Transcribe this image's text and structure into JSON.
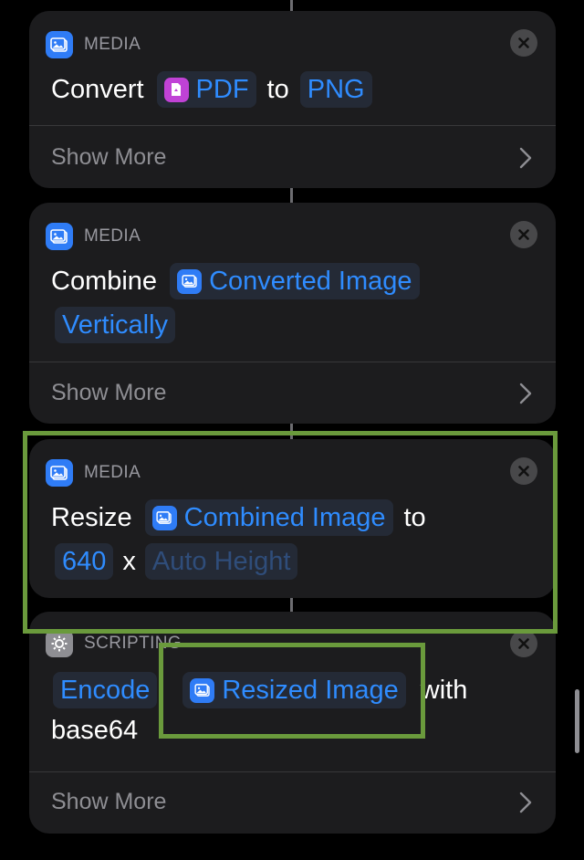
{
  "cards": [
    {
      "category": "MEDIA",
      "icon": "photo-icon",
      "words": {
        "verb": "Convert",
        "sep": "to"
      },
      "params": {
        "input": "PDF",
        "output": "PNG"
      },
      "show_more": "Show More"
    },
    {
      "category": "MEDIA",
      "icon": "photo-icon",
      "words": {
        "verb": "Combine"
      },
      "params": {
        "input": "Converted Image",
        "mode": "Vertically"
      },
      "show_more": "Show More"
    },
    {
      "category": "MEDIA",
      "icon": "photo-icon",
      "words": {
        "verb": "Resize",
        "sep": "to",
        "x": "x"
      },
      "params": {
        "input": "Combined Image",
        "width": "640",
        "height": "Auto Height"
      }
    },
    {
      "category": "SCRIPTING",
      "icon": "gear-icon",
      "words": {
        "with": "with"
      },
      "params": {
        "action": "Encode",
        "input": "Resized Image",
        "format": "base64"
      },
      "show_more": "Show More"
    }
  ],
  "colors": {
    "background": "#000000",
    "card": "#1c1c1e",
    "accent": "#2f8cff",
    "pdf_badge": "#c042d6",
    "highlight": "#6a9a3c"
  }
}
